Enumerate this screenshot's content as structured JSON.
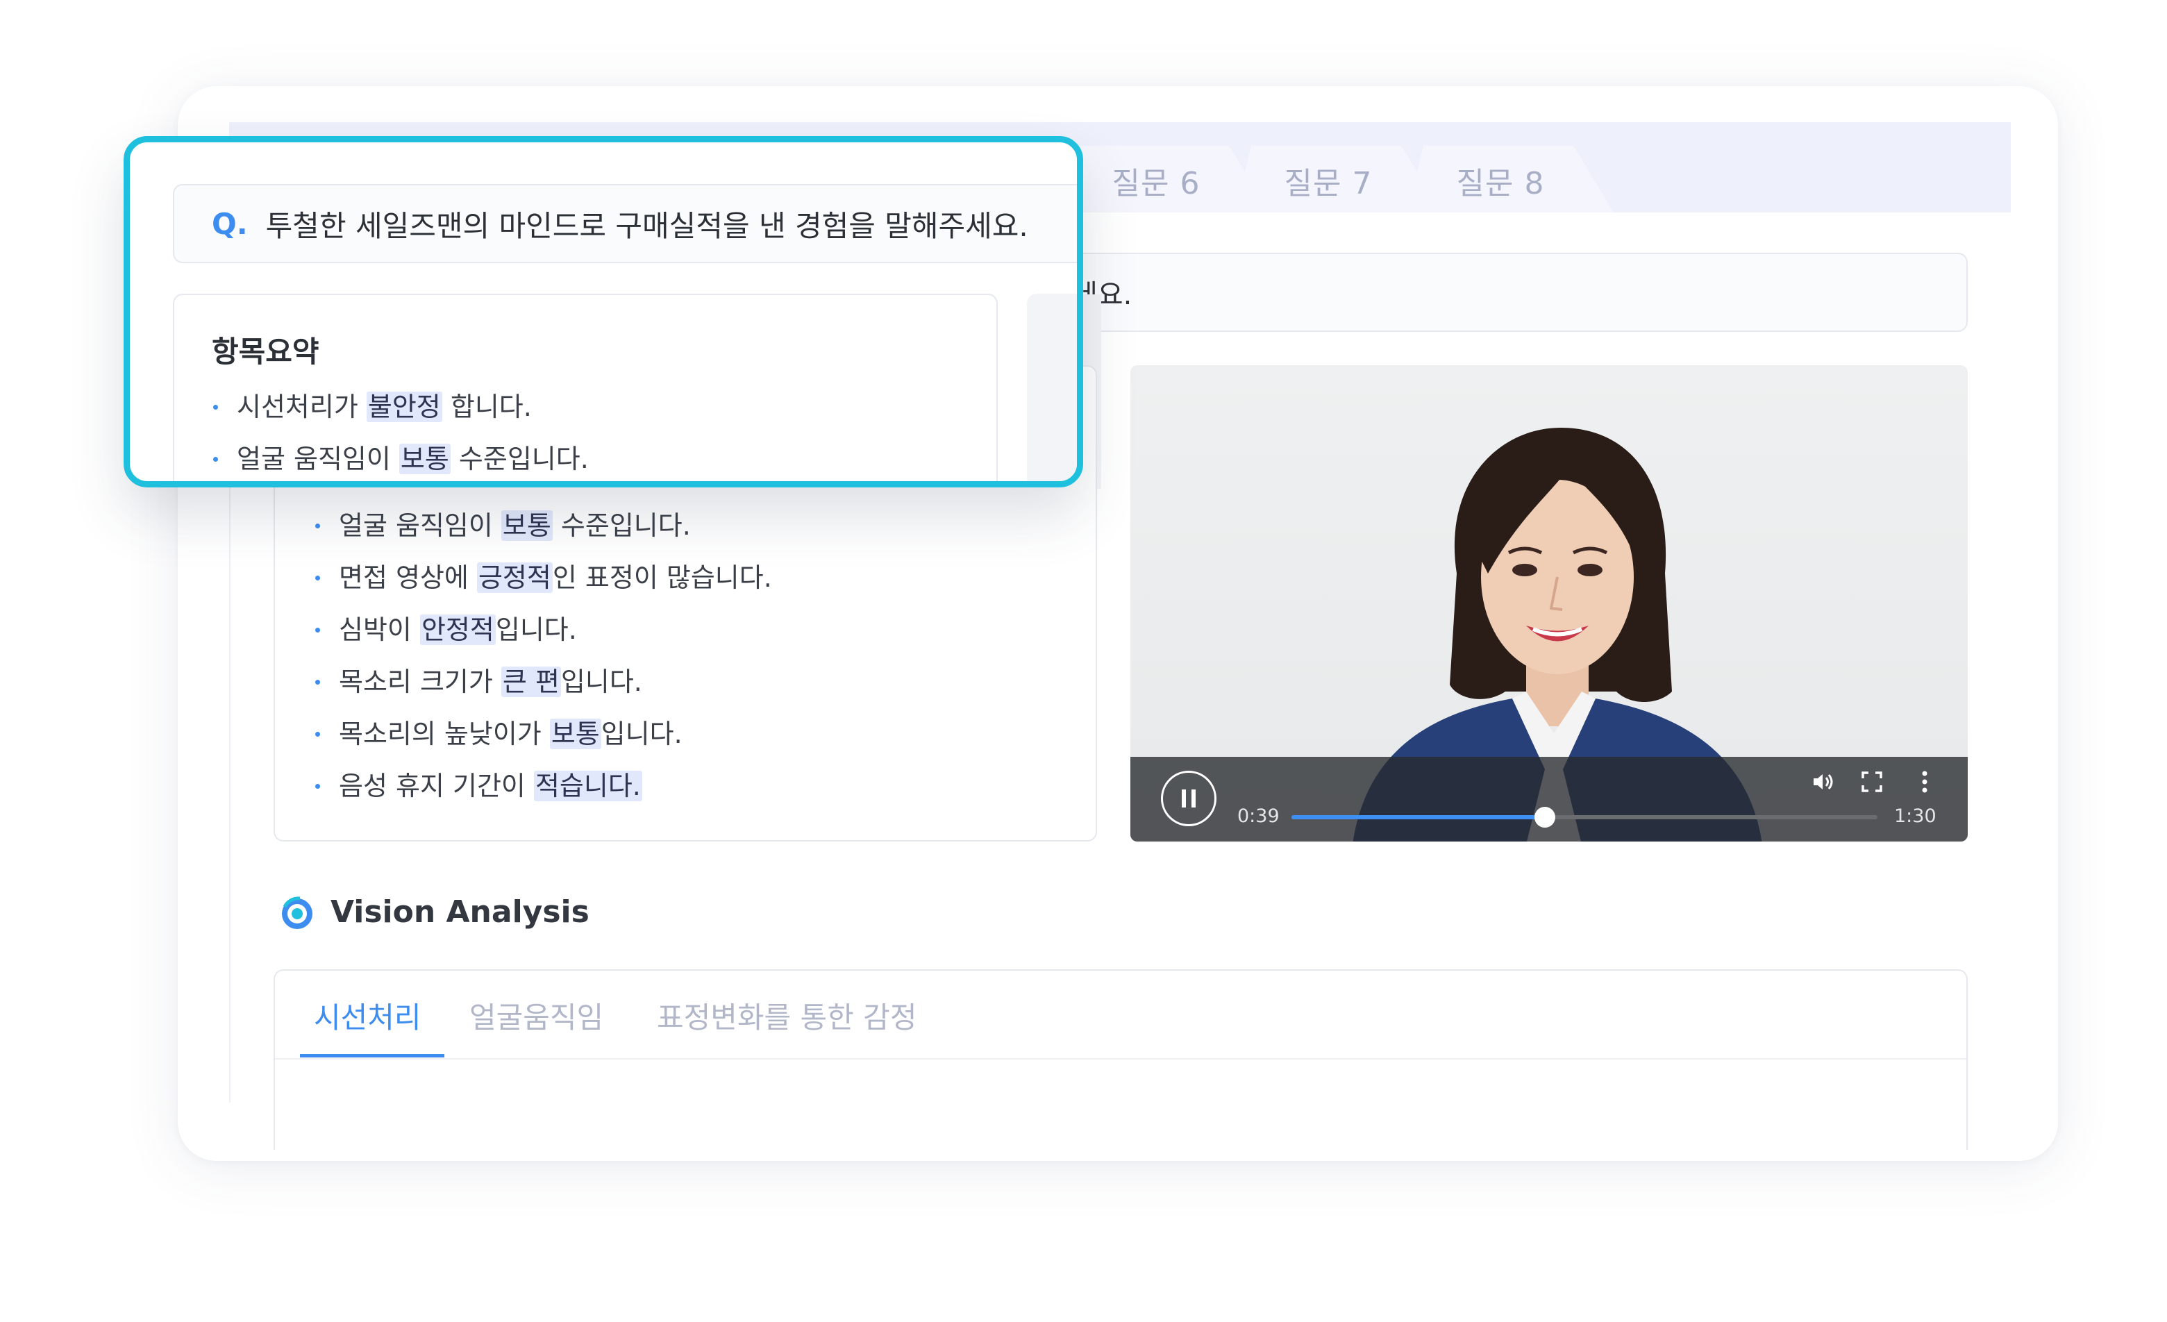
{
  "tabs": [
    "질문 6",
    "질문 7",
    "질문 8"
  ],
  "question": {
    "marker": "Q.",
    "text": "투철한 세일즈맨의 마인드로 구매실적을 낸 경험을 말해주세요.",
    "partial_visible": "세요."
  },
  "summary": {
    "title": "항목요약",
    "items": [
      {
        "pre": "시선처리가 ",
        "hl": "불안정",
        "post": " 합니다."
      },
      {
        "pre": "얼굴 움직임이 ",
        "hl": "보통",
        "post": " 수준입니다."
      },
      {
        "pre": "면접 영상에 ",
        "hl": "긍정적",
        "post": "인 표정이 많습니다."
      },
      {
        "pre": "심박이 ",
        "hl": "안정적",
        "post": "입니다."
      },
      {
        "pre": "목소리 크기가 ",
        "hl": "큰 편",
        "post": "입니다."
      },
      {
        "pre": "목소리의 높낮이가 ",
        "hl": "보통",
        "post": "입니다."
      },
      {
        "pre": "음성 휴지 기간이 ",
        "hl": "적습니다.",
        "post": ""
      }
    ]
  },
  "video": {
    "current_time": "0:39",
    "duration": "1:30",
    "progress": 0.433
  },
  "vision": {
    "title": "Vision Analysis",
    "tabs": [
      "시선처리",
      "얼굴움직임",
      "표정변화를 통한 감정"
    ],
    "active_tab": 0
  },
  "colors": {
    "accent": "#3d8df0",
    "highlight_border": "#1ec0de",
    "tab_bg": "#eef0fb"
  }
}
